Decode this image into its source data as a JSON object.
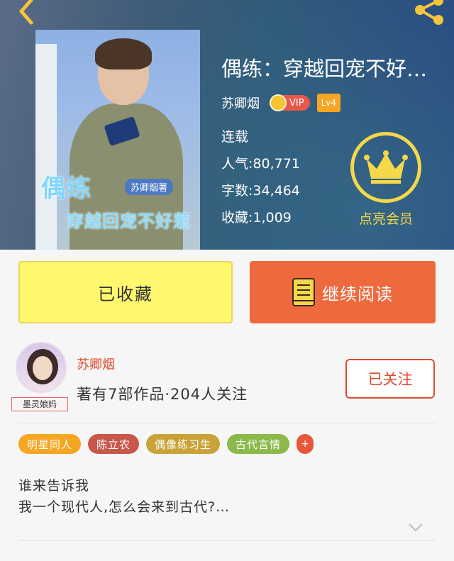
{
  "header": {
    "back_icon": "chevron-left-icon",
    "share_icon": "share-icon",
    "cover": {
      "title_line1": "偶练",
      "author_tag": "苏卿烟著",
      "title_line2": "穿越回宠不好惹"
    },
    "title": "偶练：穿越回宠不好…",
    "author": "苏卿烟",
    "vip_label": "VIP",
    "level": "Lv4",
    "status": "连载",
    "popularity": "人气:80,771",
    "word_count": "字数:34,464",
    "favorites": "收藏:1,009",
    "vip_button_label": "点亮会员",
    "accent_color": "#f5d84a"
  },
  "actions": {
    "collected_label": "已收藏",
    "read_label": "继续阅读",
    "read_icon": "book-icon"
  },
  "author_section": {
    "avatar_badge": "墨灵娘妈",
    "name": "苏卿烟",
    "meta": "著有7部作品·204人关注",
    "follow_label": "已关注"
  },
  "tags": [
    {
      "label": "明星同人",
      "color": "#f5a623"
    },
    {
      "label": "陈立农",
      "color": "#c8574b"
    },
    {
      "label": "偶像练习生",
      "color": "#c9a33a"
    },
    {
      "label": "古代言情",
      "color": "#8bb94a"
    }
  ],
  "tag_more": "+",
  "intro": "谁来告诉我\n我一个现代人,怎么会来到古代?…",
  "expand_icon": "chevron-down-icon"
}
